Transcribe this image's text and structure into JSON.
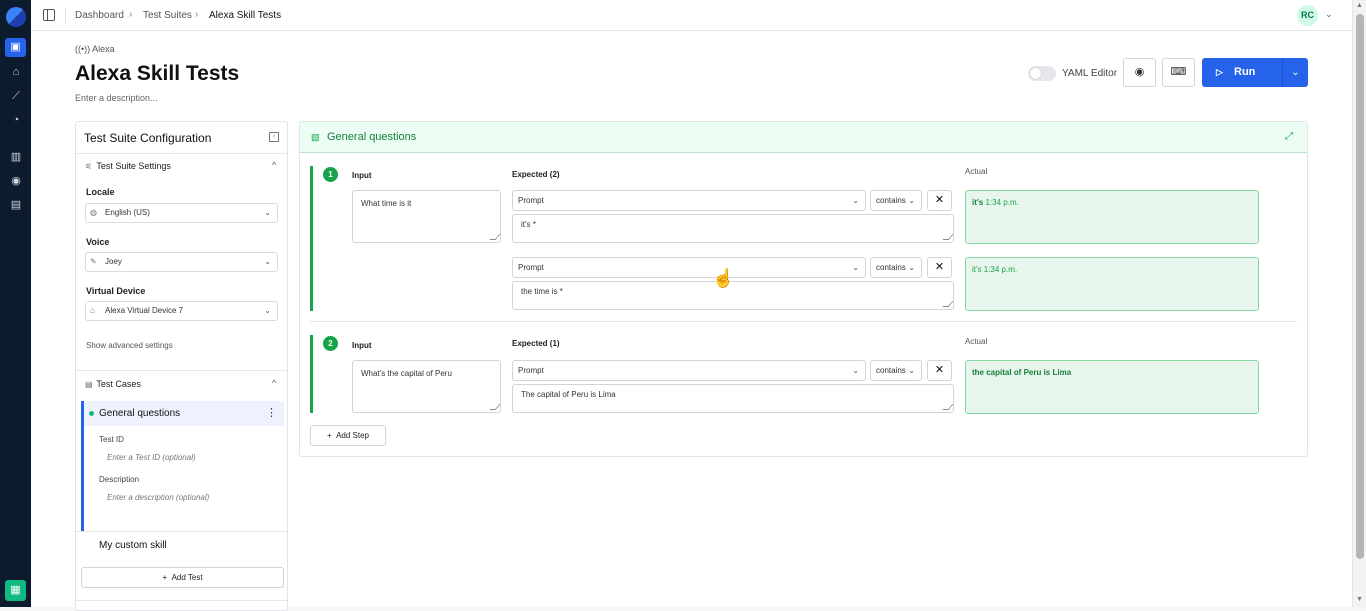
{
  "breadcrumb": [
    "Dashboard",
    "Test Suites",
    "Alexa Skill Tests"
  ],
  "user": {
    "initials": "RC"
  },
  "header": {
    "brand": "Alexa",
    "title": "Alexa Skill Tests",
    "description_placeholder": "Enter a description...",
    "yaml_label": "YAML Editor",
    "yaml_enabled": false,
    "run_label": "Run"
  },
  "config": {
    "title": "Test Suite Configuration",
    "settings_title": "Test Suite Settings",
    "locale_label": "Locale",
    "locale_value": "English (US)",
    "voice_label": "Voice",
    "voice_value": "Joey",
    "device_label": "Virtual Device",
    "device_value": "Alexa Virtual Device 7",
    "advanced": "Show advanced settings",
    "test_cases_title": "Test Cases",
    "active_case": "General questions",
    "test_id_label": "Test ID",
    "test_id_placeholder": "Enter a Test ID (optional)",
    "description_label": "Description",
    "description_placeholder": "Enter a description (optional)",
    "other_case": "My custom skill",
    "add_test": "Add Test"
  },
  "panel": {
    "title": "General questions",
    "add_step": "Add Step",
    "actual_label": "Actual",
    "input_label": "Input",
    "steps": [
      {
        "number": "1",
        "expected_label": "Expected (2)",
        "input": "What time is it",
        "expectations": [
          {
            "type": "Prompt",
            "operator": "contains",
            "value": "it's *",
            "actual_bold": "it's",
            "actual_rest": " 1:34 p.m."
          },
          {
            "type": "Prompt",
            "operator": "contains",
            "value": "the time is *",
            "actual_bold": "",
            "actual_rest": "it's 1:34 p.m."
          }
        ]
      },
      {
        "number": "2",
        "expected_label": "Expected (1)",
        "input": "What's the capital of Peru",
        "expectations": [
          {
            "type": "Prompt",
            "operator": "contains",
            "value": "The capital of Peru is Lima",
            "actual_bold": "the capital of Peru is Lima",
            "actual_rest": ""
          }
        ]
      }
    ]
  },
  "colors": {
    "accent": "#2563eb",
    "success": "#16a34a",
    "rail": "#0c1b2e"
  }
}
